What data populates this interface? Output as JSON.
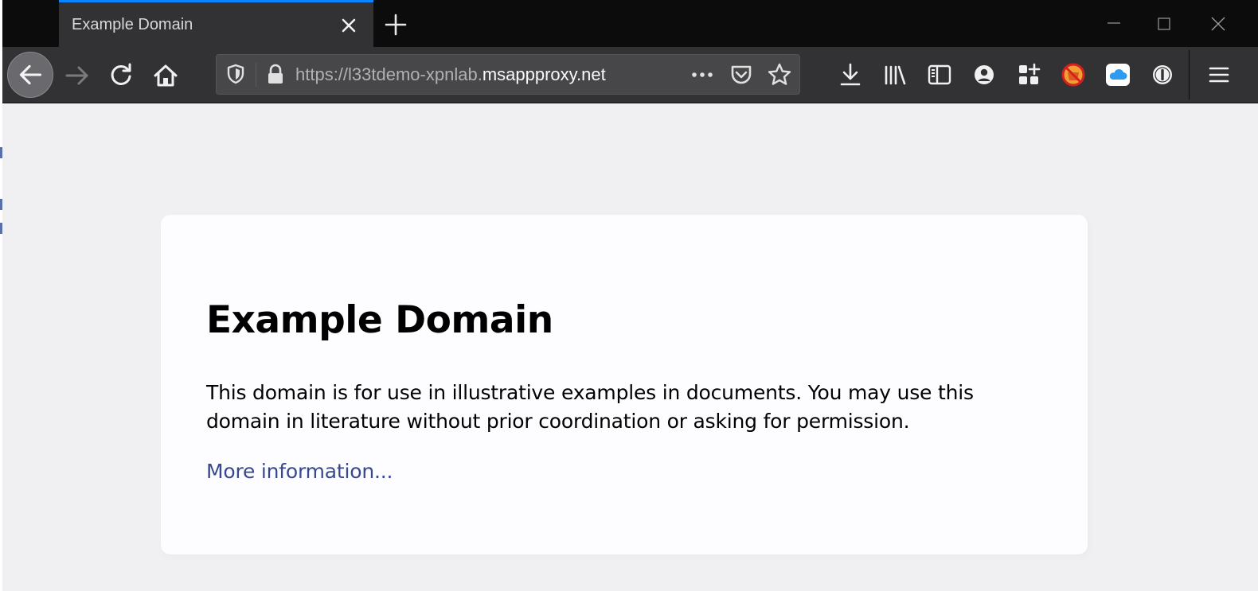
{
  "browser": {
    "tabs": [
      {
        "title": "Example Domain",
        "active": true
      }
    ],
    "url": {
      "prefix": "https://l33tdemo-xpnlab.",
      "host": "msappproxy.net"
    },
    "accent_color": "#0a84ff"
  },
  "page": {
    "heading": "Example Domain",
    "paragraph": "This domain is for use in illustrative examples in documents. You may use this domain in literature without prior coordination or asking for permission.",
    "link_text": "More information..."
  },
  "icons": {
    "toolbar": [
      "download-icon",
      "library-icon",
      "sidebar-icon",
      "account-icon",
      "extensions-icon",
      "blocker-extension-icon",
      "icloud-extension-icon",
      "password-extension-icon",
      "menu-icon"
    ]
  }
}
